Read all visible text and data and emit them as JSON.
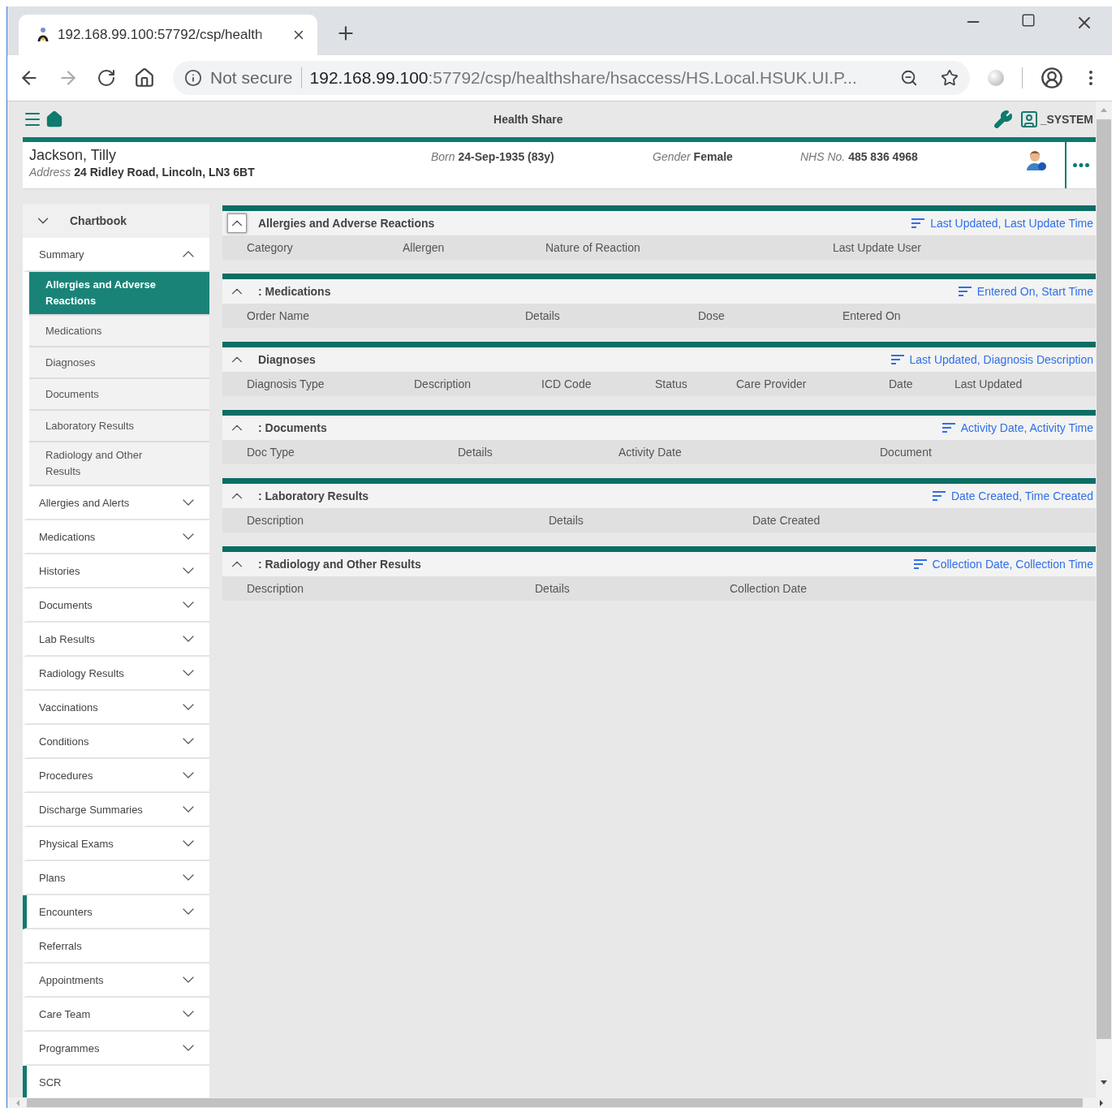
{
  "browser": {
    "tab_title": "192.168.99.100:57792/csp/health",
    "security_label": "Not secure",
    "url_host": "192.168.99.100",
    "url_rest": ":57792/csp/healthshare/hsaccess/HS.Local.HSUK.UI.P..."
  },
  "app_header": {
    "title": "Health Share",
    "user": "_SYSTEM"
  },
  "patient": {
    "name": "Jackson, Tilly",
    "address_label": "Address",
    "address": "24 Ridley Road,  Lincoln,  LN3 6BT",
    "born_label": "Born",
    "born": "24-Sep-1935 (83y)",
    "gender_label": "Gender",
    "gender": "Female",
    "nhs_label": "NHS No.",
    "nhs": "485 836 4968"
  },
  "sidebar": {
    "header": {
      "label": "Chartbook",
      "expanded": true
    },
    "items": [
      {
        "label": "Summary",
        "expandable": true,
        "expanded": true,
        "highlighted": false,
        "children": [
          {
            "label": "Allergies and Adverse Reactions",
            "selected": true
          },
          {
            "label": "Medications",
            "selected": false
          },
          {
            "label": "Diagnoses",
            "selected": false
          },
          {
            "label": "Documents",
            "selected": false
          },
          {
            "label": "Laboratory Results",
            "selected": false
          },
          {
            "label": "Radiology and Other Results",
            "selected": false
          }
        ]
      },
      {
        "label": "Allergies and Alerts",
        "expandable": true,
        "expanded": false,
        "highlighted": false
      },
      {
        "label": "Medications",
        "expandable": true,
        "expanded": false,
        "highlighted": false
      },
      {
        "label": "Histories",
        "expandable": true,
        "expanded": false,
        "highlighted": false
      },
      {
        "label": "Documents",
        "expandable": true,
        "expanded": false,
        "highlighted": false
      },
      {
        "label": "Lab Results",
        "expandable": true,
        "expanded": false,
        "highlighted": false
      },
      {
        "label": "Radiology Results",
        "expandable": true,
        "expanded": false,
        "highlighted": false
      },
      {
        "label": "Vaccinations",
        "expandable": true,
        "expanded": false,
        "highlighted": false
      },
      {
        "label": "Conditions",
        "expandable": true,
        "expanded": false,
        "highlighted": false
      },
      {
        "label": "Procedures",
        "expandable": true,
        "expanded": false,
        "highlighted": false
      },
      {
        "label": "Discharge Summaries",
        "expandable": true,
        "expanded": false,
        "highlighted": false
      },
      {
        "label": "Physical Exams",
        "expandable": true,
        "expanded": false,
        "highlighted": false
      },
      {
        "label": "Plans",
        "expandable": true,
        "expanded": false,
        "highlighted": false
      },
      {
        "label": "Encounters",
        "expandable": true,
        "expanded": false,
        "highlighted": true
      },
      {
        "label": "Referrals",
        "expandable": false,
        "highlighted": false
      },
      {
        "label": "Appointments",
        "expandable": true,
        "expanded": false,
        "highlighted": false
      },
      {
        "label": "Care Team",
        "expandable": true,
        "expanded": false,
        "highlighted": false
      },
      {
        "label": "Programmes",
        "expandable": true,
        "expanded": false,
        "highlighted": false
      },
      {
        "label": "SCR",
        "expandable": false,
        "highlighted": true
      }
    ]
  },
  "sections": [
    {
      "title": "Allergies and Adverse Reactions",
      "expanded": true,
      "focused": true,
      "sort": "Last Updated, Last Update Time",
      "columns": [
        "Category",
        "Allergen",
        "Nature of Reaction",
        "Last Update User"
      ]
    },
    {
      "title": ": Medications",
      "expanded": true,
      "focused": false,
      "sort": "Entered On, Start Time",
      "columns": [
        "Order Name",
        "Details",
        "Dose",
        "Entered On"
      ]
    },
    {
      "title": "Diagnoses",
      "expanded": true,
      "focused": false,
      "sort": "Last Updated, Diagnosis Description",
      "columns": [
        "Diagnosis Type",
        "Description",
        "ICD Code",
        "Status",
        "Care Provider",
        "Date",
        "Last Updated"
      ]
    },
    {
      "title": ": Documents",
      "expanded": true,
      "focused": false,
      "sort": "Activity Date, Activity Time",
      "columns": [
        "Doc Type",
        "Details",
        "Activity Date",
        "Document"
      ]
    },
    {
      "title": ": Laboratory Results",
      "expanded": true,
      "focused": false,
      "sort": "Date Created, Time Created",
      "columns": [
        "Description",
        "Details",
        "Date Created"
      ]
    },
    {
      "title": ": Radiology and Other Results",
      "expanded": true,
      "focused": false,
      "sort": "Collection Date, Collection Time",
      "columns": [
        "Description",
        "Details",
        "Collection Date"
      ]
    }
  ]
}
